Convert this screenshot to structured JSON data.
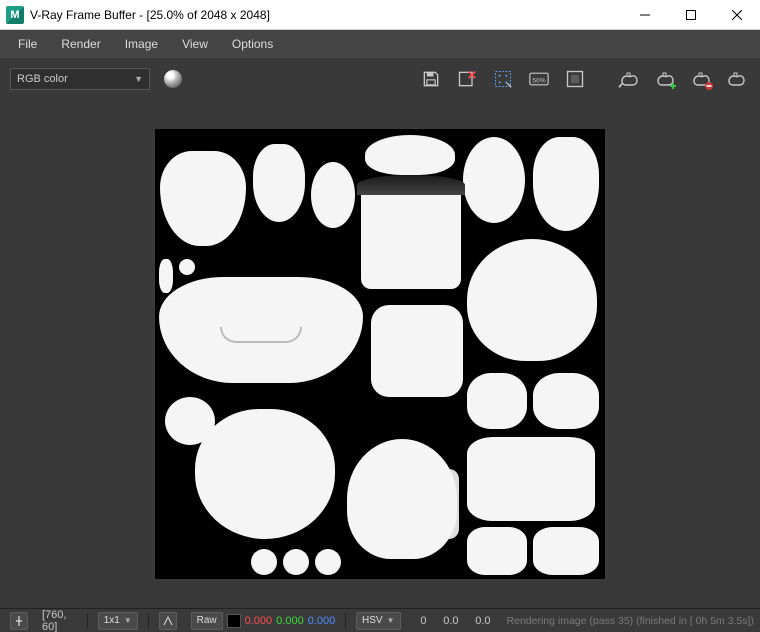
{
  "window": {
    "title": "V-Ray Frame Buffer - [25.0% of 2048 x 2048]"
  },
  "menu": {
    "items": [
      "File",
      "Render",
      "Image",
      "View",
      "Options"
    ]
  },
  "toolbar": {
    "channel_selector": "RGB color",
    "icons": {
      "sphere": "color-sphere-icon",
      "save": "save-image-icon",
      "save_x": "delete-saved-image-icon",
      "region": "region-render-icon",
      "fifty": "50%",
      "fit": "fit-window-icon",
      "tp1": "teapot-last-icon",
      "tp2": "teapot-add-icon",
      "tp3": "teapot-remove-icon",
      "tp4": "teapot-icon"
    }
  },
  "status": {
    "pin": "pin-icon",
    "cursor_coords": "[760, 60]",
    "zoom_combo": "1x1",
    "arrow": "arrow-icon",
    "raw_label": "Raw",
    "r": "0.000",
    "g": "0.000",
    "b": "0.000",
    "mode_combo": "HSV",
    "h": "0",
    "s": "0.0",
    "v": "0.0",
    "message": "Rendering image (pass 35) (finished in [ 0h  5m  3.5s])"
  }
}
